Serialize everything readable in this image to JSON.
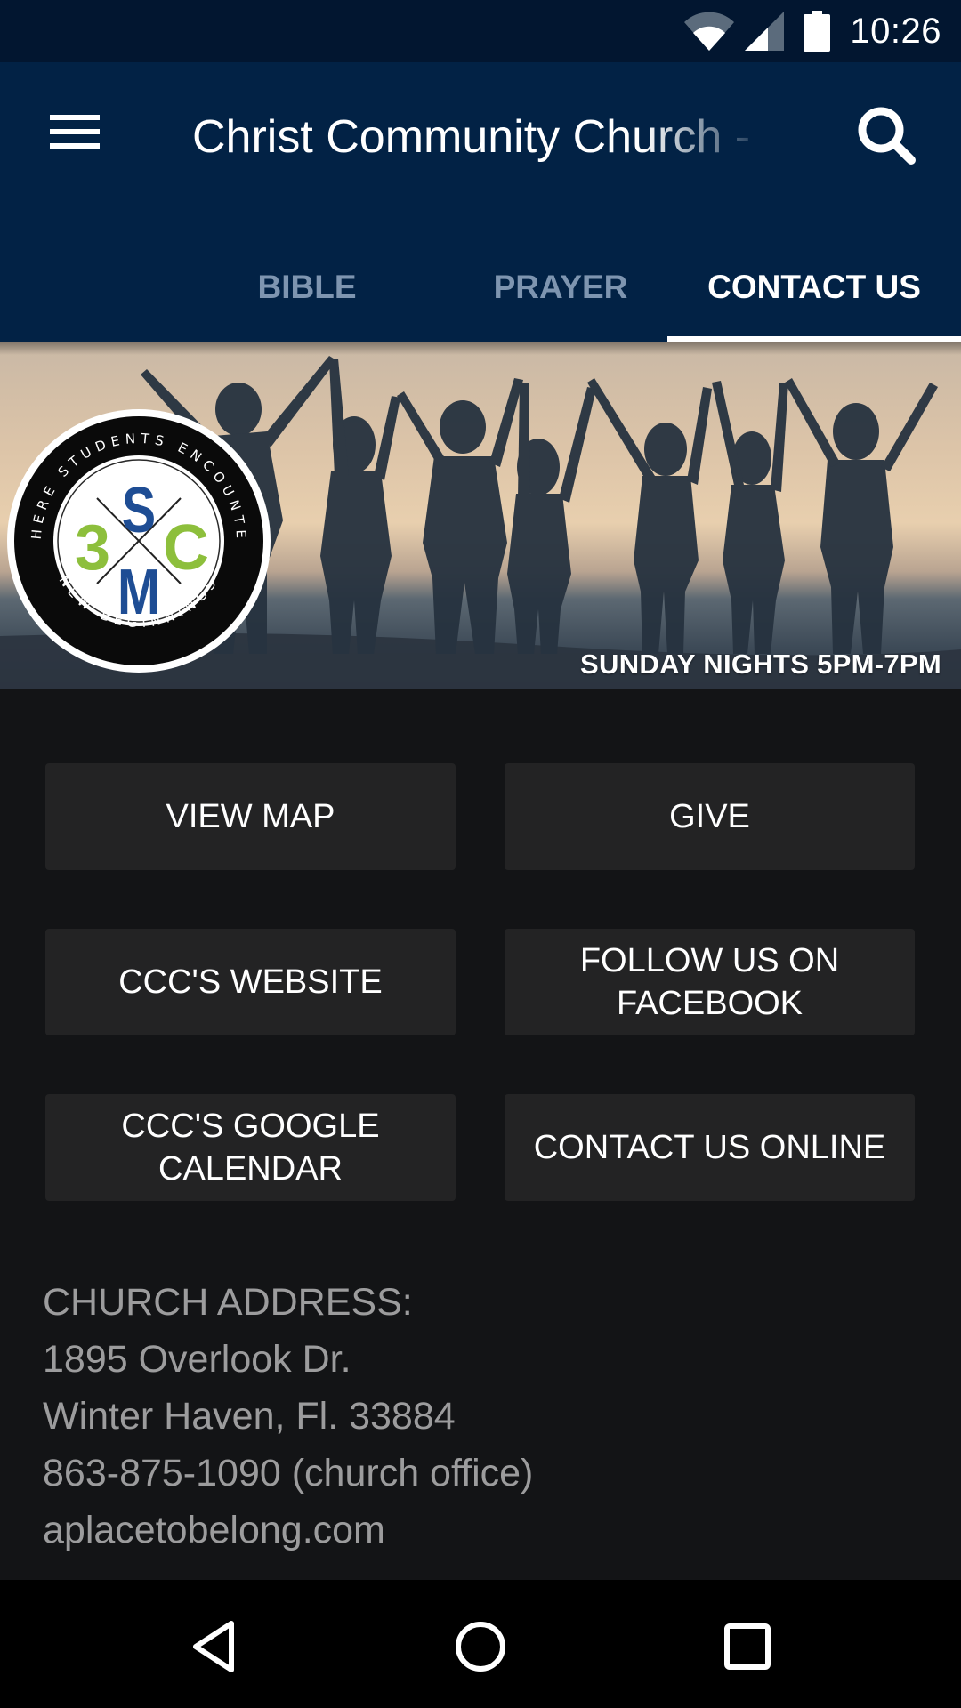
{
  "status_bar": {
    "time": "10:26",
    "icons": [
      "wifi-icon",
      "cell-signal-icon",
      "battery-icon"
    ]
  },
  "app_bar": {
    "title": "Christ Community Church - ",
    "menu_icon": "hamburger-menu-icon",
    "search_icon": "search-icon"
  },
  "tabs": [
    {
      "label": "",
      "active": false
    },
    {
      "label": "BIBLE",
      "active": false
    },
    {
      "label": "PRAYER",
      "active": false
    },
    {
      "label": "CONTACT US",
      "active": true
    }
  ],
  "banner": {
    "logo": {
      "top_arc": "WHERE STUDENTS ENCOUNTER",
      "bottom_arc": "NEW BEGINNINGS",
      "letters": {
        "top": "S",
        "left": "3",
        "right": "C",
        "bottom": "M"
      }
    },
    "caption": "SUNDAY NIGHTS 5PM-7PM",
    "colors": {
      "logo_blue": "#1e4d94",
      "logo_green": "#8dbf3c"
    }
  },
  "buttons": [
    {
      "label": "VIEW MAP"
    },
    {
      "label": "GIVE"
    },
    {
      "label": "CCC'S WEBSITE"
    },
    {
      "label": "FOLLOW US ON\nFACEBOOK"
    },
    {
      "label": "CCC'S GOOGLE\nCALENDAR"
    },
    {
      "label": "CONTACT US ONLINE"
    }
  ],
  "address": {
    "heading": "CHURCH ADDRESS:",
    "street": "1895 Overlook Dr.",
    "city": "Winter Haven, Fl. 33884",
    "phone": "863-875-1090 (church office)",
    "website": "aplacetobelong.com"
  },
  "nav_bar": {
    "back": "back-icon",
    "home": "home-icon",
    "recents": "recents-icon"
  },
  "theme": {
    "status_bar_bg": "#021630",
    "app_bar_bg": "#022245",
    "page_bg": "#131416",
    "button_bg": "#232324",
    "tab_inactive": "#7e95b0",
    "tab_active": "#ffffff"
  }
}
